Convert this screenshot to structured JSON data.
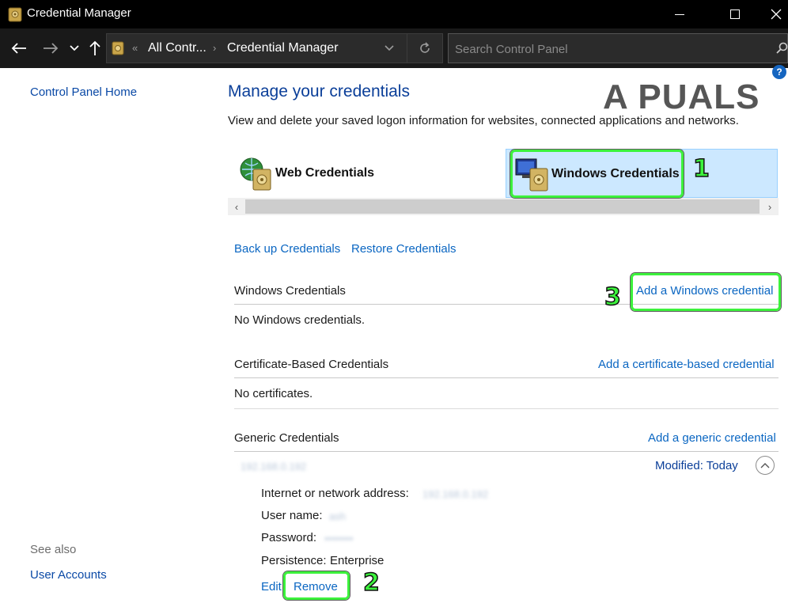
{
  "window": {
    "title": "Credential Manager"
  },
  "addressbar": {
    "crumbs": [
      "All Contr...",
      "Credential Manager"
    ],
    "overflow_glyph": "«",
    "search_placeholder": "Search Control Panel"
  },
  "left": {
    "home_link": "Control Panel Home",
    "see_also": "See also",
    "see_also_links": [
      "User Accounts"
    ]
  },
  "header": {
    "title": "Manage your credentials",
    "subtitle": "View and delete your saved logon information for websites, connected applications and networks."
  },
  "tabs": [
    {
      "label": "Web Credentials",
      "icon": "globe-vault-icon",
      "selected": false
    },
    {
      "label": "Windows Credentials",
      "icon": "computer-vault-icon",
      "selected": true
    }
  ],
  "actions": {
    "backup": "Back up Credentials",
    "restore": "Restore Credentials"
  },
  "sections": {
    "windows": {
      "title": "Windows Credentials",
      "add": "Add a Windows credential",
      "empty": "No Windows credentials."
    },
    "certificate": {
      "title": "Certificate-Based Credentials",
      "add": "Add a certificate-based credential",
      "empty": "No certificates."
    },
    "generic": {
      "title": "Generic Credentials",
      "add": "Add a generic credential",
      "entry": {
        "name": "192.168.0.192",
        "modified_label": "Modified:",
        "modified_value": "Today",
        "fields": {
          "address_label": "Internet or network address:",
          "address_value": "192.168.0.192",
          "user_label": "User name:",
          "user_value": "ash",
          "password_label": "Password:",
          "password_value": "••••••••",
          "persistence_label": "Persistence:",
          "persistence_value": "Enterprise"
        },
        "edit": "Edit",
        "remove": "Remove"
      }
    }
  },
  "annotations": {
    "step1": "1",
    "step2": "2",
    "step3": "3",
    "highlight_color": "#3cf23c"
  },
  "watermark": "A PUALS",
  "colors": {
    "link": "#0a66c2",
    "heading": "#0b3f99",
    "selected_tab": "#cce8ff"
  }
}
